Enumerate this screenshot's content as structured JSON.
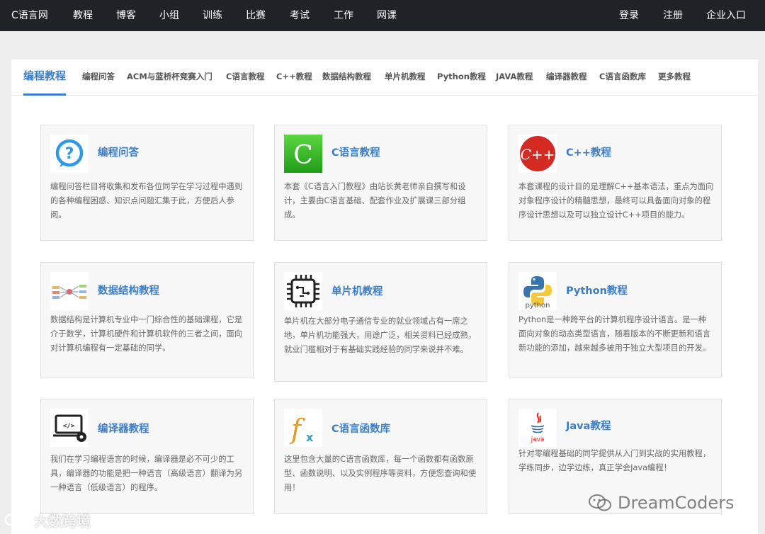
{
  "nav": {
    "brand": "C语言网",
    "items": [
      "教程",
      "博客",
      "小组",
      "训练",
      "比赛",
      "考试",
      "工作",
      "网课"
    ],
    "right": [
      "登录",
      "注册",
      "企业入口"
    ]
  },
  "tabs": {
    "active": "编程教程",
    "items": [
      "编程问答",
      "ACM与蓝桥杯竞赛入门",
      "C语言教程",
      "C++教程",
      "数据结构教程",
      "单片机教程",
      "Python教程",
      "JAVA教程",
      "编译器教程",
      "C语言函数库",
      "更多教程"
    ]
  },
  "cards": [
    {
      "title": "编程问答",
      "icon": "question-icon",
      "desc": "编程问答栏目将收集和发布各位同学在学习过程中遇到的各种编程困惑、知识点问题汇集于此，方便后人参阅。"
    },
    {
      "title": "C语言教程",
      "icon": "c-language-icon",
      "desc": "本套《C语言入门教程》由站长黄老师亲自撰写和设计，主要由C语言基础、配套作业及扩展课三部分组成。"
    },
    {
      "title": "C++教程",
      "icon": "cpp-icon",
      "desc": "本套课程的设计目的是理解C++基本语法，重点为面向对象程序设计的精髓思想，最终可以具备面向对象的程序设计思想以及可以独立设计C++项目的能力。"
    },
    {
      "title": "数据结构教程",
      "icon": "data-structure-icon",
      "desc": "数据结构是计算机专业中一门综合性的基础课程，它是介于数学，计算机硬件和计算机软件的三者之间，面向对计算机编程有一定基础的同学。"
    },
    {
      "title": "单片机教程",
      "icon": "chip-icon",
      "desc": "单片机在大部分电子通信专业的就业领域占有一席之地，单片机功能强大，用途广泛，相关资料已经成熟，就业门槛相对于有基础实践经验的同学来说并不难。"
    },
    {
      "title": "Python教程",
      "icon": "python-icon",
      "desc": "Python是一种跨平台的计算机程序设计语言。是一种面向对象的动态类型语言，随着版本的不断更新和语言新功能的添加，越来越多被用于独立大型项目的开发。"
    },
    {
      "title": "编译器教程",
      "icon": "compiler-icon",
      "desc": "我们在学习编程语言的时候，编译器是必不可少的工具，编译器的功能是把一种语言（高级语言）翻译为另一种语言（低级语言）的程序。"
    },
    {
      "title": "C语言函数库",
      "icon": "function-icon",
      "desc": "这里包含大量的C语言函数库，每一个函数都有函数原型、函数说明、以及实例程序等资料，方便您查询和使用！"
    },
    {
      "title": "Java教程",
      "icon": "java-icon",
      "desc": "针对零编程基础的同学提供从入门到实战的实用教程，学练同步，边学边练，真正学会Java编程！"
    }
  ],
  "watermarks": {
    "left": "大数跨境",
    "right": "DreamCoders"
  },
  "colors": {
    "nav_bg": "#1f2227",
    "accent": "#3b7dc8",
    "card_bg": "#f7f7f7",
    "page_bg": "#eeeeee"
  }
}
